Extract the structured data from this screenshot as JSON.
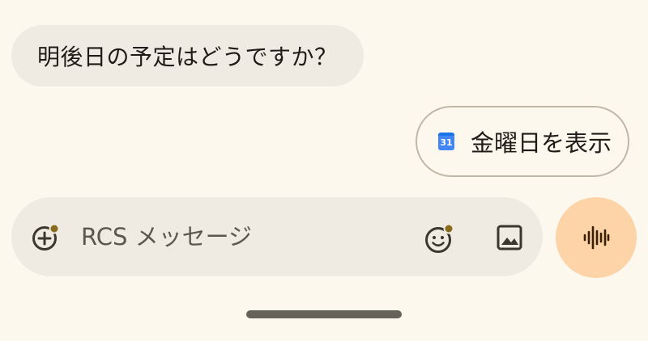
{
  "messages": [
    {
      "direction": "incoming",
      "text": "明後日の予定はどうですか？"
    }
  ],
  "suggestion": {
    "icon": "google-calendar-icon",
    "calendar_day": "31",
    "label": "金曜日を表示"
  },
  "composer": {
    "placeholder": "RCS メッセージ",
    "add_icon": "add-circle-icon",
    "emoji_icon": "emoji-icon",
    "image_icon": "image-icon"
  },
  "voice_button": {
    "icon": "waveform-icon"
  },
  "colors": {
    "background": "#fcf8ee",
    "bubble": "#efebe2",
    "voice_button": "#fdd4a8",
    "accent_dot": "#8a6a1c"
  }
}
